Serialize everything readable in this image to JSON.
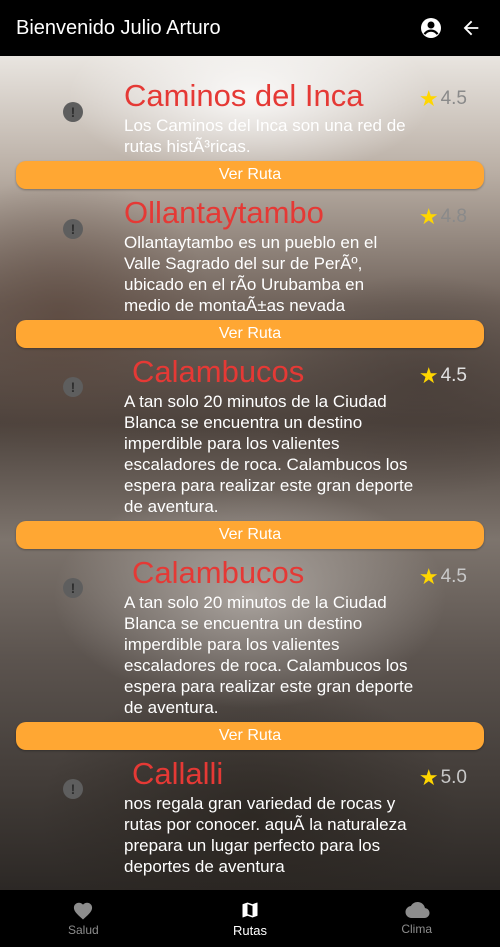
{
  "appbar": {
    "title": "Bienvenido Julio Arturo",
    "profile_icon": "account-circle-icon",
    "back_icon": "arrow-back-icon"
  },
  "routes": [
    {
      "name": "Caminos del Inca",
      "rating": "4.5",
      "description": "Los Caminos del Inca son una red de rutas histÃ³ricas.",
      "button": "Ver Ruta"
    },
    {
      "name": "Ollantaytambo",
      "rating": "4.8",
      "description": "Ollantaytambo es un pueblo en el Valle Sagrado del sur de PerÃº, ubicado en el rÃo Urubamba en medio de montaÃ±as nevada",
      "button": "Ver Ruta"
    },
    {
      "name": "Calambucos",
      "rating": "4.5",
      "description": "A tan solo 20 minutos de la Ciudad Blanca se encuentra un destino imperdible para los valientes escaladores de roca. Calambucos los espera para realizar este gran deporte de aventura.",
      "button": "Ver Ruta"
    },
    {
      "name": "Calambucos",
      "rating": "4.5",
      "description": "A tan solo 20 minutos de la Ciudad Blanca se encuentra un destino imperdible para los valientes escaladores de roca. Calambucos los espera para realizar este gran deporte de aventura.",
      "button": "Ver Ruta"
    },
    {
      "name": "Callalli",
      "rating": "5.0",
      "description": "nos regala gran variedad de rocas y rutas por conocer. aquÃ la naturaleza prepara un lugar perfecto para los deportes de aventura",
      "button": ""
    }
  ],
  "nav": [
    {
      "label": "Salud",
      "icon": "heart-icon"
    },
    {
      "label": "Rutas",
      "icon": "map-icon"
    },
    {
      "label": "Clima",
      "icon": "cloud-icon"
    }
  ],
  "colors": {
    "accent": "#ffa733",
    "title_red": "#e53935",
    "star": "#ffd600"
  }
}
